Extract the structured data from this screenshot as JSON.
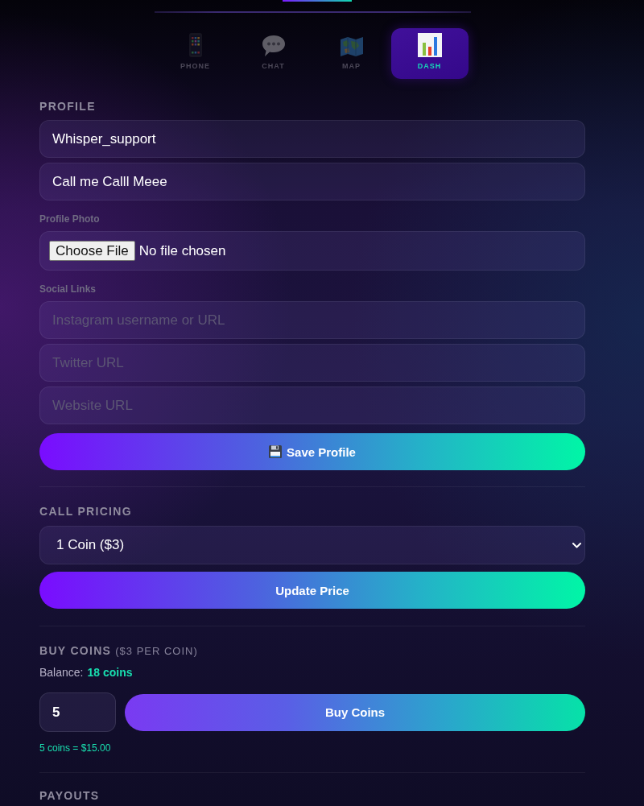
{
  "tabs": [
    {
      "label": "PHONE",
      "selected": false
    },
    {
      "label": "CHAT",
      "selected": false
    },
    {
      "label": "MAP",
      "selected": false
    },
    {
      "label": "DASH",
      "selected": true
    }
  ],
  "profile": {
    "heading": "PROFILE",
    "fields": [
      {
        "value": "Whisper_support"
      },
      {
        "value": "Call me Calll Meee"
      }
    ],
    "photo": {
      "label": "Profile Photo",
      "button": "Choose File",
      "status": "No file chosen"
    },
    "social": {
      "label": "Social Links",
      "fields": [
        {
          "placeholder": "Instagram username or URL"
        },
        {
          "placeholder": "Twitter URL"
        },
        {
          "placeholder": "Website URL"
        }
      ]
    },
    "save_button": "Save Profile"
  },
  "call_pricing": {
    "heading": "CALL PRICING",
    "select": {
      "value": "1 Coin ($3)"
    },
    "button": "Update Price"
  },
  "buy_coins": {
    "heading": "BUY COINS",
    "note": "($3 PER COIN)",
    "balance_label": "Balance:",
    "balance_value": "18 coins",
    "quantity": {
      "value": "5"
    },
    "button": "Buy Coins",
    "total": "5 coins = $15.00"
  },
  "payouts": {
    "heading": "PAYOUTS"
  }
}
